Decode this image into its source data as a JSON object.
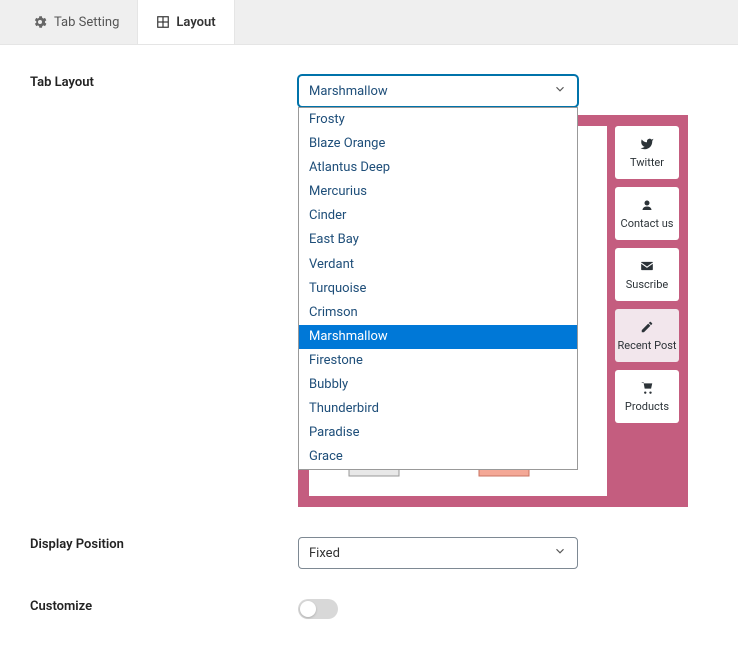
{
  "tabs": {
    "setting_label": "Tab Setting",
    "layout_label": "Layout"
  },
  "fields": {
    "tab_layout_label": "Tab Layout",
    "display_position_label": "Display Position",
    "customize_label": "Customize"
  },
  "tab_layout": {
    "selected": "Marshmallow",
    "options": [
      "Frosty",
      "Blaze Orange",
      "Atlantus Deep",
      "Mercurius",
      "Cinder",
      "East Bay",
      "Verdant",
      "Turquoise",
      "Crimson",
      "Marshmallow",
      "Firestone",
      "Bubbly",
      "Thunderbird",
      "Paradise",
      "Grace"
    ]
  },
  "display_position": {
    "selected": "Fixed"
  },
  "preview_side": {
    "twitter": "Twitter",
    "contact": "Contact us",
    "suscribe": "Suscribe",
    "recent": "Recent Post",
    "products": "Products"
  }
}
